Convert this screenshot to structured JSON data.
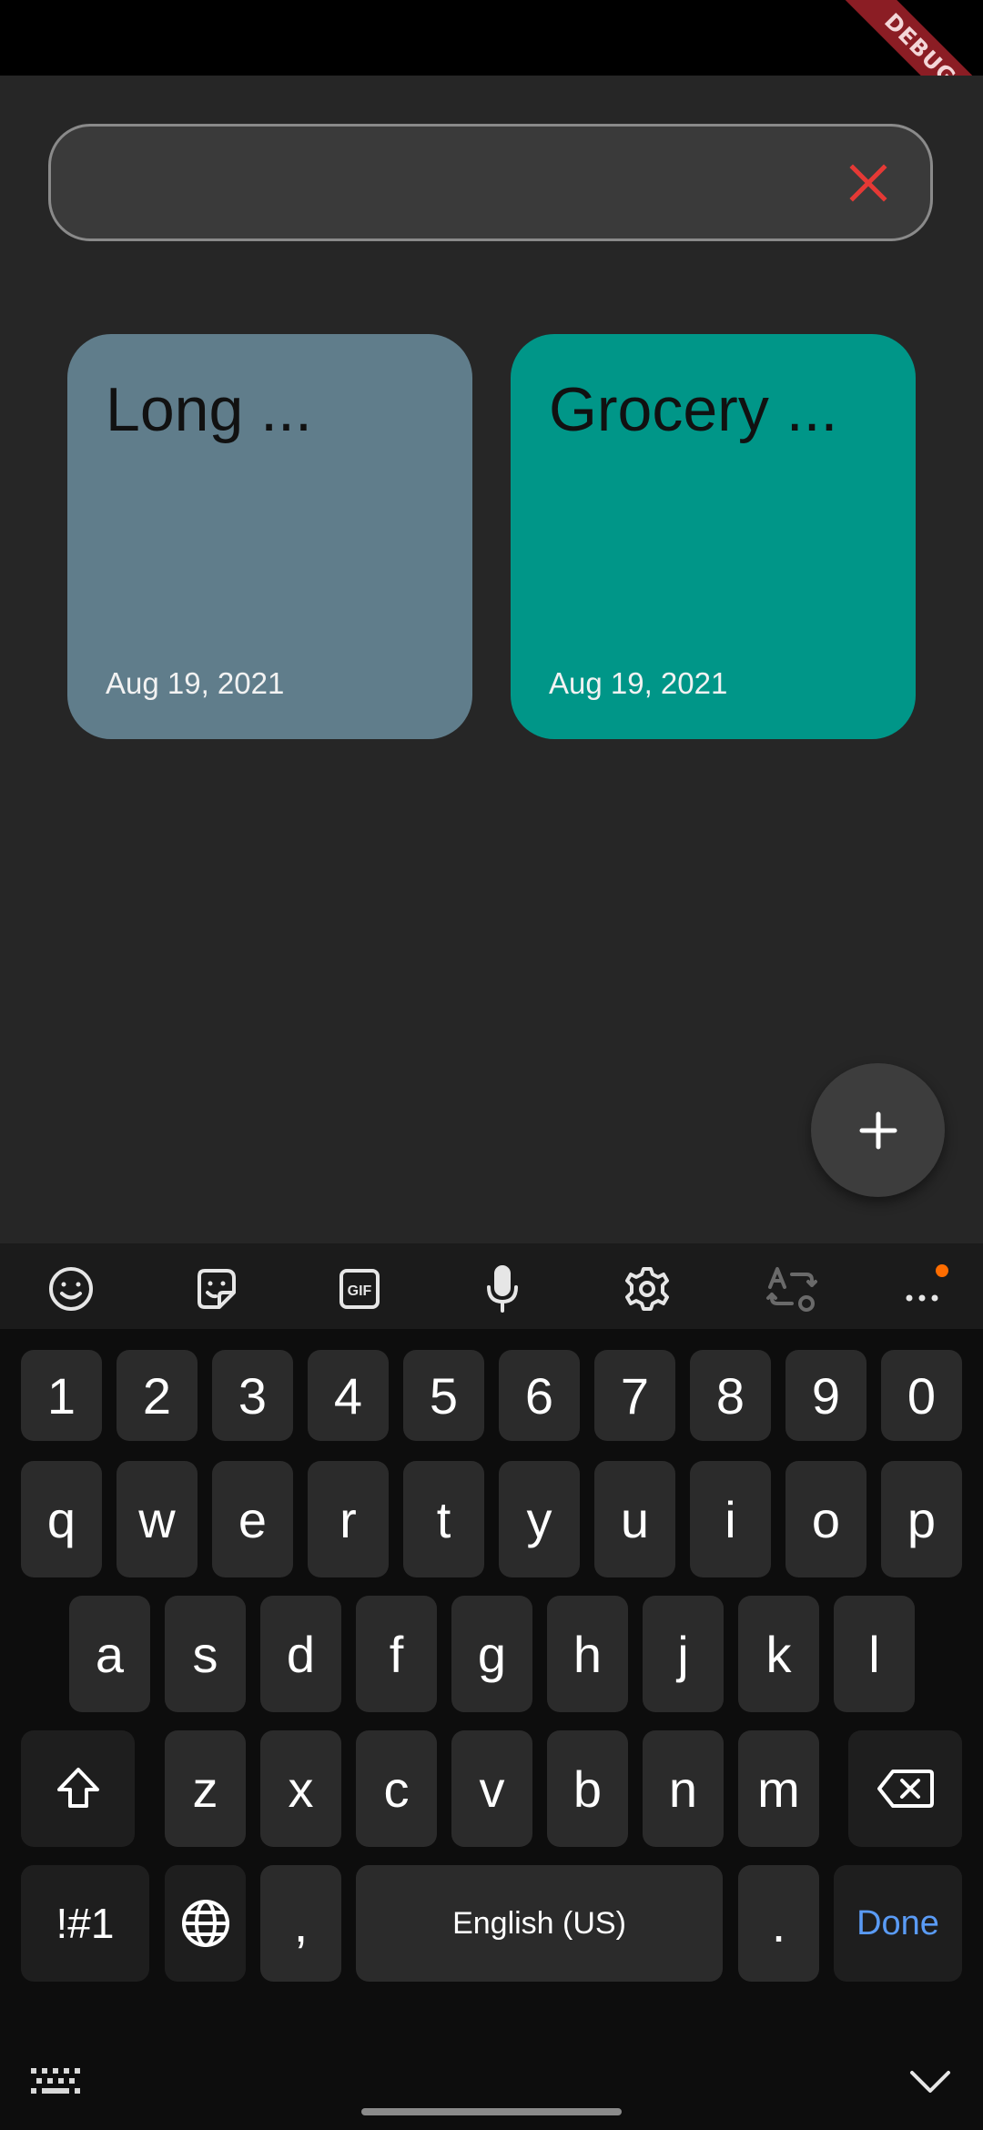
{
  "debug_banner": "DEBUG",
  "search": {
    "value": "",
    "placeholder": ""
  },
  "notes": [
    {
      "title": "Long ...",
      "date": "Aug 19, 2021",
      "color": "#607d8b"
    },
    {
      "title": "Grocery ...",
      "date": "Aug 19, 2021",
      "color": "#009688"
    }
  ],
  "colors": {
    "clear_icon": "#e53935",
    "accent": "#5a9bf5",
    "notification_dot": "#ff6d00"
  },
  "keyboard": {
    "toolbar_icons": [
      "emoji-icon",
      "sticker-icon",
      "gif-icon",
      "microphone-icon",
      "settings-icon",
      "translate-icon",
      "more-icon"
    ],
    "gif_label": "GIF",
    "number_row": [
      "1",
      "2",
      "3",
      "4",
      "5",
      "6",
      "7",
      "8",
      "9",
      "0"
    ],
    "row1": [
      "q",
      "w",
      "e",
      "r",
      "t",
      "y",
      "u",
      "i",
      "o",
      "p"
    ],
    "row2": [
      "a",
      "s",
      "d",
      "f",
      "g",
      "h",
      "j",
      "k",
      "l"
    ],
    "row3": [
      "z",
      "x",
      "c",
      "v",
      "b",
      "n",
      "m"
    ],
    "symbols_label": "!#1",
    "comma": ",",
    "space_label": "English (US)",
    "period": ".",
    "done_label": "Done"
  }
}
